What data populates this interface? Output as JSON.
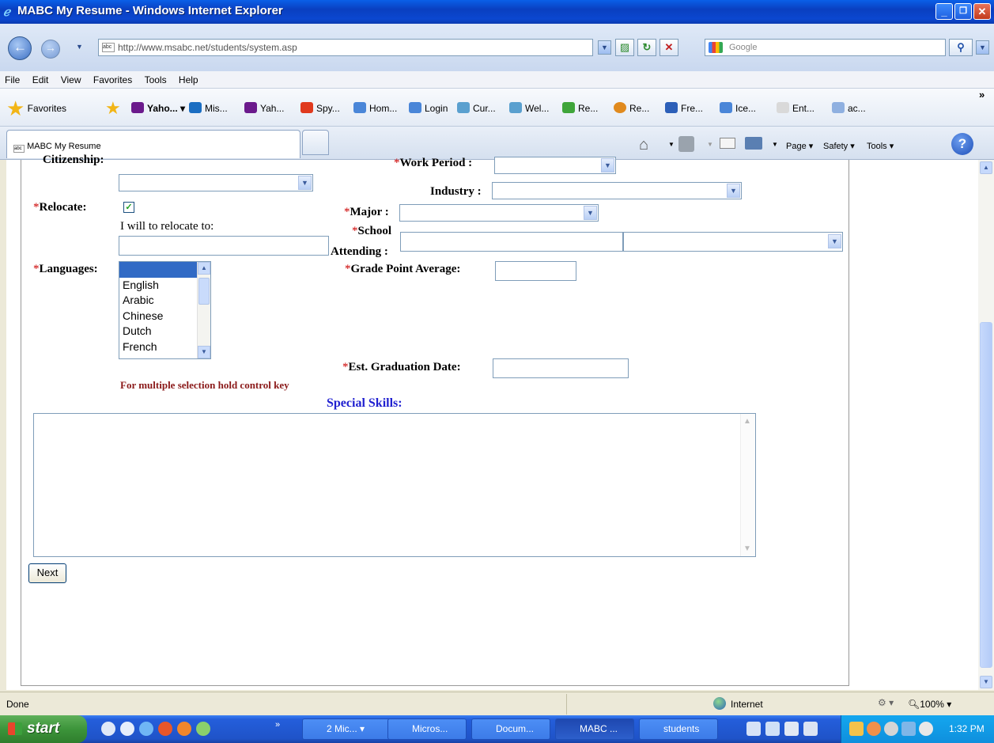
{
  "window": {
    "title": "MABC My Resume - Windows Internet Explorer",
    "minimize": "_",
    "restore": "❐",
    "close": "✕"
  },
  "address": {
    "url": "http://www.msabc.net/students/system.asp",
    "search_placeholder": "Google"
  },
  "menu": [
    "File",
    "Edit",
    "View",
    "Favorites",
    "Tools",
    "Help"
  ],
  "favorites": {
    "label": "Favorites",
    "items": [
      "Yaho...",
      "Mis...",
      "Yah...",
      "Spy...",
      "Hom...",
      "Login",
      "Cur...",
      "Wel...",
      "Re...",
      "Re...",
      "Fre...",
      "Ice...",
      "Ent...",
      "ac..."
    ],
    "more": "»"
  },
  "tab": {
    "title": "MABC My Resume"
  },
  "commandbar": {
    "page": "Page",
    "safety": "Safety",
    "tools": "Tools"
  },
  "form": {
    "citizenship_label": "Citizenship:",
    "work_period_label": "Work Period :",
    "industry_label": "Industry :",
    "relocate_label": "Relocate:",
    "relocate_checked": true,
    "relocate_hint": "I will to relocate to:",
    "major_label": "Major :",
    "school_label": "School",
    "attending_label": "Attending :",
    "languages_label": "Languages:",
    "languages": [
      "",
      "English",
      "Arabic",
      "Chinese",
      "Dutch",
      "French"
    ],
    "gpa_label": "Grade Point Average:",
    "graduation_label": "Est. Graduation Date:",
    "multi_hint": "For multiple selection hold control key",
    "skills_label": "Special Skills:",
    "next_button": "Next",
    "required_mark": "*"
  },
  "status": {
    "text": "Done",
    "zone": "Internet",
    "zoom": "100%"
  },
  "taskbar": {
    "start": "start",
    "items": [
      "2 Mic...",
      "Micros...",
      "Docum...",
      "MABC ...",
      "students"
    ],
    "active_index": 3,
    "clock": "1:32 PM"
  }
}
